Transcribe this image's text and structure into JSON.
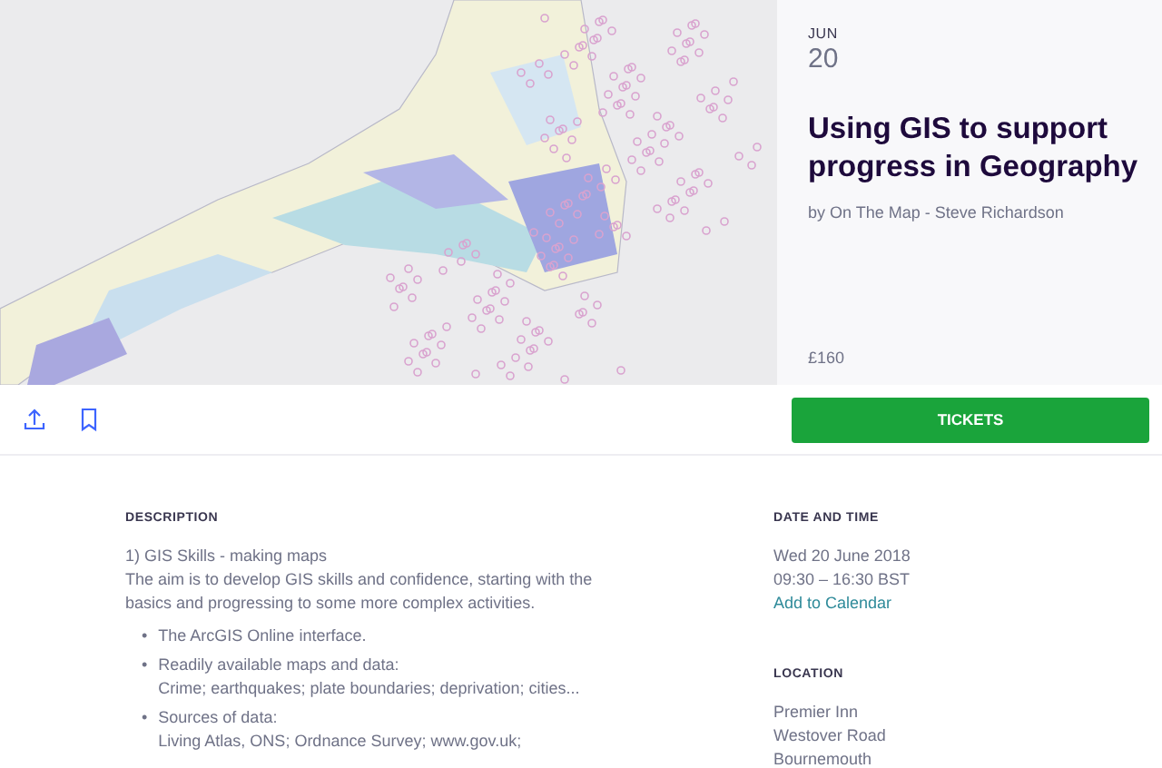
{
  "event": {
    "month": "JUN",
    "day": "20",
    "title": "Using GIS to support progress in Geography",
    "organizer": "by On The Map - Steve Richardson",
    "price": "£160"
  },
  "actions": {
    "tickets_button": "TICKETS"
  },
  "description": {
    "heading": "DESCRIPTION",
    "subtitle": "1) GIS Skills - making maps",
    "intro": "The aim is to develop GIS skills and confidence, starting with the basics and progressing to some more complex activities.",
    "bullets": [
      {
        "marker": "•",
        "lines": [
          "The ArcGIS Online interface."
        ]
      },
      {
        "marker": "•",
        "lines": [
          "Readily available maps and data:",
          "Crime; earthquakes; plate boundaries; deprivation; cities..."
        ]
      },
      {
        "marker": "•",
        "lines": [
          "Sources of data:",
          "Living Atlas, ONS; Ordnance Survey; www.gov.uk;"
        ]
      }
    ]
  },
  "date_and_time": {
    "heading": "DATE AND TIME",
    "lines": [
      "Wed 20 June 2018",
      "09:30 – 16:30 BST"
    ],
    "link": "Add to Calendar"
  },
  "location": {
    "heading": "LOCATION",
    "lines": [
      "Premier Inn",
      "Westover Road",
      "Bournemouth"
    ]
  }
}
